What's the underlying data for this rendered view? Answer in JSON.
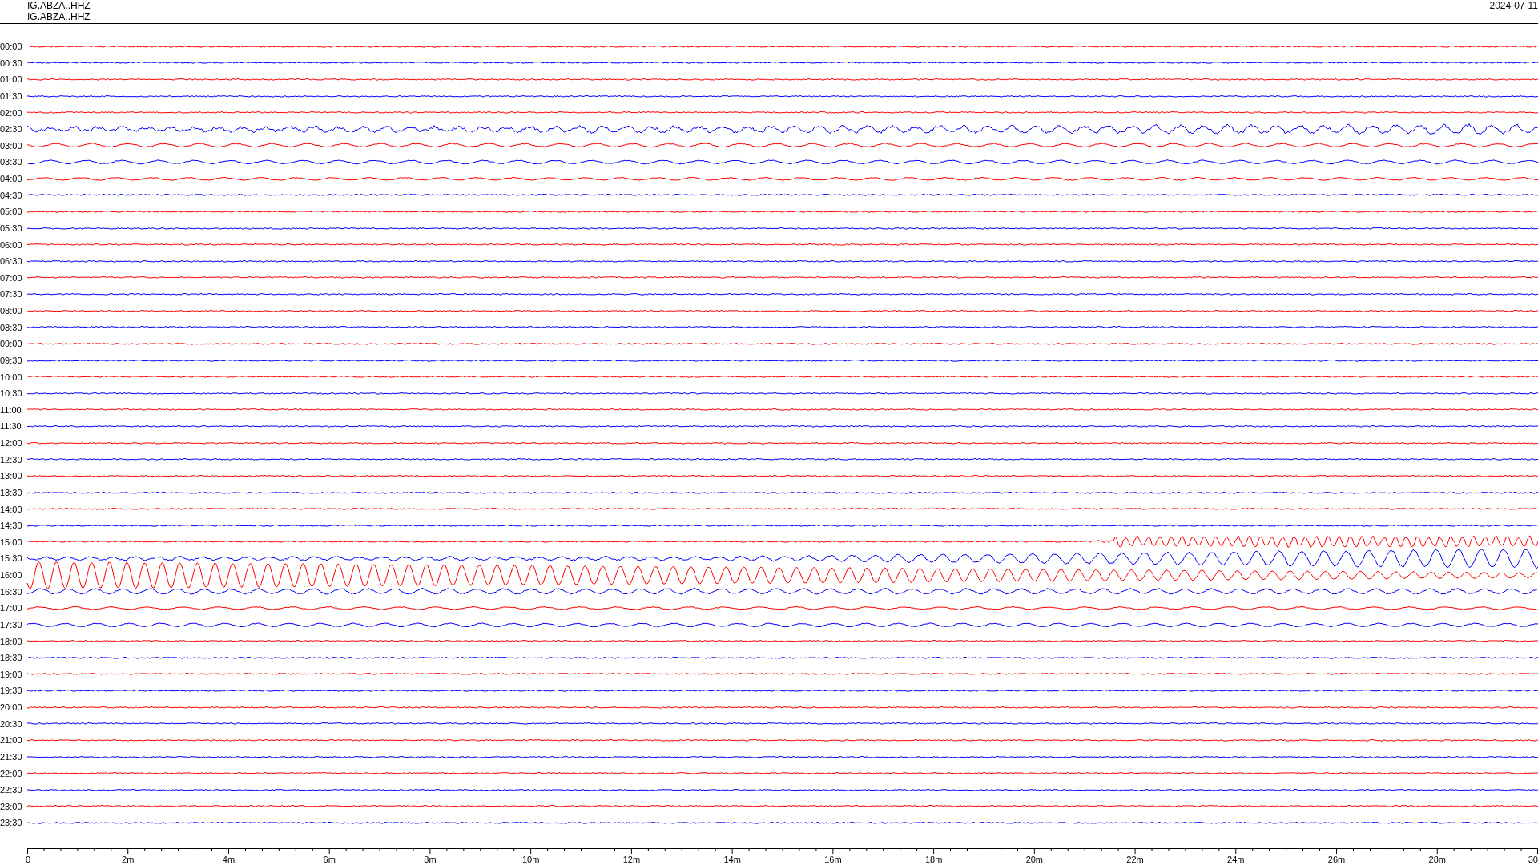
{
  "header": {
    "station_labels": [
      "IG.ABZA..HHZ",
      "IG.ABZA..HHZ"
    ],
    "date": "2024-07-11"
  },
  "rows": [
    {
      "label": "00:00",
      "color": "#ff0000"
    },
    {
      "label": "00:30",
      "color": "#0000ff"
    },
    {
      "label": "01:00",
      "color": "#ff0000"
    },
    {
      "label": "01:30",
      "color": "#0000ff"
    },
    {
      "label": "02:00",
      "color": "#ff0000"
    },
    {
      "label": "02:30",
      "color": "#0000ff"
    },
    {
      "label": "03:00",
      "color": "#ff0000"
    },
    {
      "label": "03:30",
      "color": "#0000ff"
    },
    {
      "label": "04:00",
      "color": "#ff0000"
    },
    {
      "label": "04:30",
      "color": "#0000ff"
    },
    {
      "label": "05:00",
      "color": "#ff0000"
    },
    {
      "label": "05:30",
      "color": "#0000ff"
    },
    {
      "label": "06:00",
      "color": "#ff0000"
    },
    {
      "label": "06:30",
      "color": "#0000ff"
    },
    {
      "label": "07:00",
      "color": "#ff0000"
    },
    {
      "label": "07:30",
      "color": "#0000ff"
    },
    {
      "label": "08:00",
      "color": "#ff0000"
    },
    {
      "label": "08:30",
      "color": "#0000ff"
    },
    {
      "label": "09:00",
      "color": "#ff0000"
    },
    {
      "label": "09:30",
      "color": "#0000ff"
    },
    {
      "label": "10:00",
      "color": "#ff0000"
    },
    {
      "label": "10:30",
      "color": "#0000ff"
    },
    {
      "label": "11:00",
      "color": "#ff0000"
    },
    {
      "label": "11:30",
      "color": "#0000ff"
    },
    {
      "label": "12:00",
      "color": "#ff0000"
    },
    {
      "label": "12:30",
      "color": "#0000ff"
    },
    {
      "label": "13:00",
      "color": "#ff0000"
    },
    {
      "label": "13:30",
      "color": "#0000ff"
    },
    {
      "label": "14:00",
      "color": "#ff0000"
    },
    {
      "label": "14:30",
      "color": "#0000ff"
    },
    {
      "label": "15:00",
      "color": "#ff0000"
    },
    {
      "label": "15:30",
      "color": "#0000ff"
    },
    {
      "label": "16:00",
      "color": "#ff0000"
    },
    {
      "label": "16:30",
      "color": "#0000ff"
    },
    {
      "label": "17:00",
      "color": "#ff0000"
    },
    {
      "label": "17:30",
      "color": "#0000ff"
    },
    {
      "label": "18:00",
      "color": "#ff0000"
    },
    {
      "label": "18:30",
      "color": "#0000ff"
    },
    {
      "label": "19:00",
      "color": "#ff0000"
    },
    {
      "label": "19:30",
      "color": "#0000ff"
    },
    {
      "label": "20:00",
      "color": "#ff0000"
    },
    {
      "label": "20:30",
      "color": "#0000ff"
    },
    {
      "label": "21:00",
      "color": "#ff0000"
    },
    {
      "label": "21:30",
      "color": "#0000ff"
    },
    {
      "label": "22:00",
      "color": "#ff0000"
    },
    {
      "label": "22:30",
      "color": "#0000ff"
    },
    {
      "label": "23:00",
      "color": "#ff0000"
    },
    {
      "label": "23:30",
      "color": "#0000ff"
    }
  ],
  "time_axis": {
    "tick_labels": [
      "0",
      "2m",
      "4m",
      "6m",
      "8m",
      "10m",
      "12m",
      "14m",
      "16m",
      "18m",
      "20m",
      "22m",
      "24m",
      "26m",
      "28m",
      "30"
    ]
  }
}
